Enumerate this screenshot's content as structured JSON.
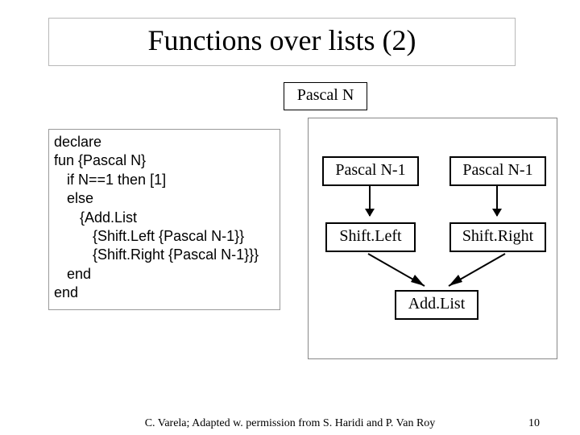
{
  "title": "Functions over lists (2)",
  "root_node": "Pascal N",
  "code": {
    "l1": "declare",
    "l2": "fun {Pascal N}",
    "l3": "if N==1 then [1]",
    "l4": "else",
    "l5": "{Add.List",
    "l6": "{Shift.Left {Pascal N-1}}",
    "l7": "{Shift.Right {Pascal N-1}}}",
    "l8": "end",
    "l9": "end"
  },
  "nodes": {
    "pn1": "Pascal N-1",
    "shift_left": "Shift.Left",
    "shift_right": "Shift.Right",
    "addlist": "Add.List"
  },
  "footer": {
    "credit": "C. Varela;  Adapted w. permission from S. Haridi and P. Van Roy",
    "page": "10"
  }
}
